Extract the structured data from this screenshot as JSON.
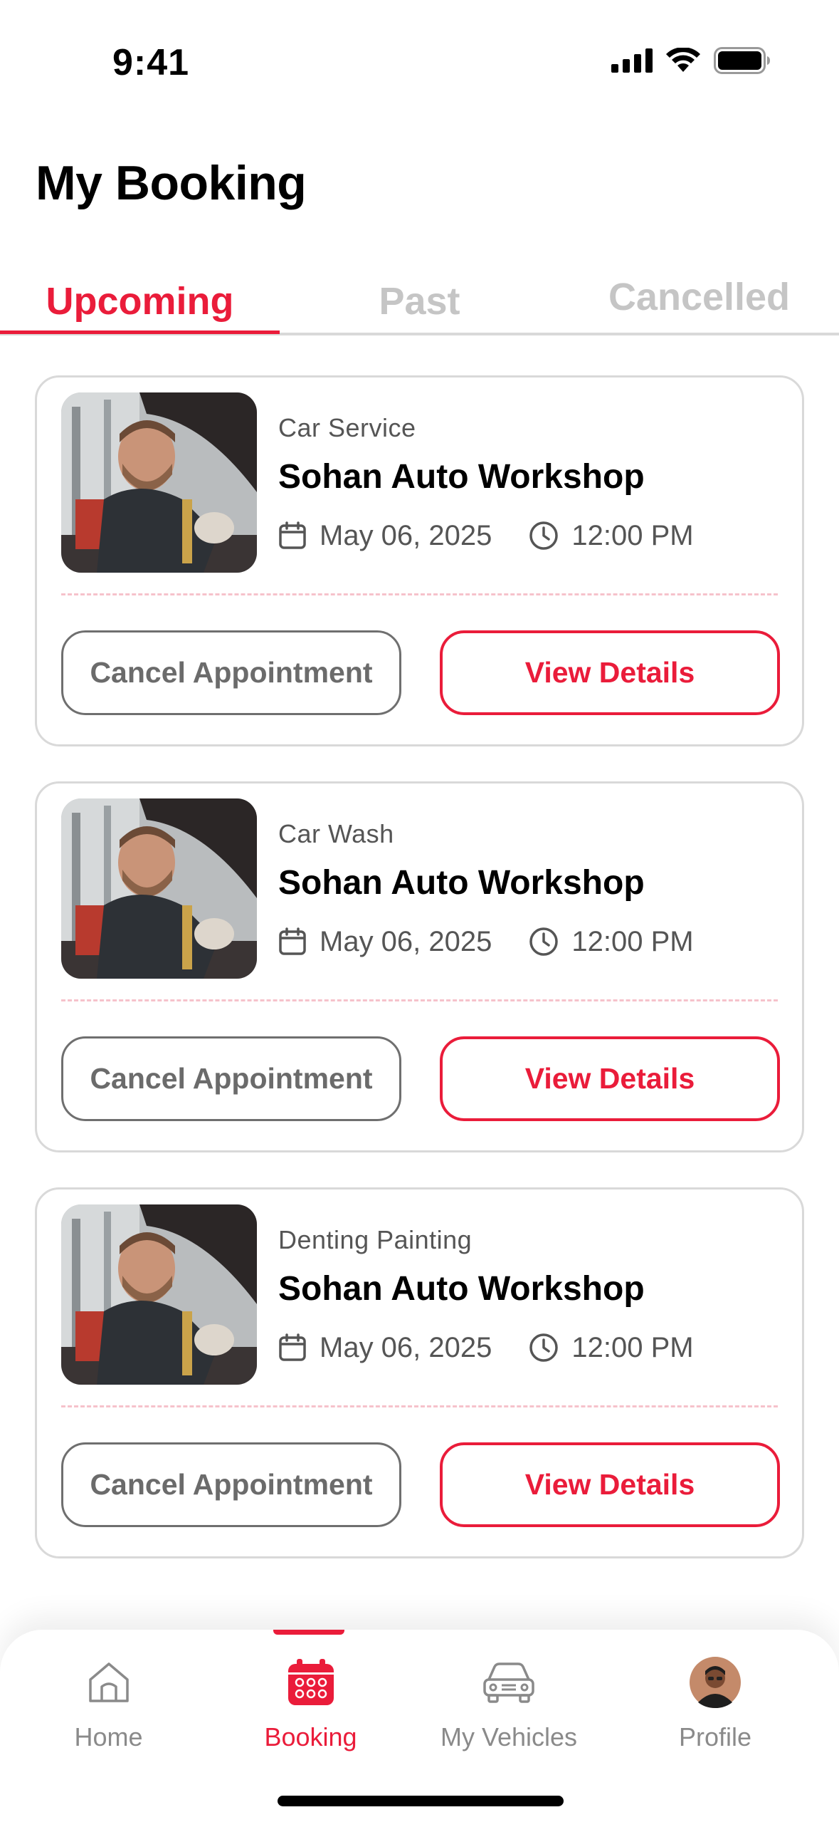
{
  "status_bar": {
    "time": "9:41"
  },
  "page_title": "My Booking",
  "tabs": [
    {
      "label": "Upcoming",
      "active": true
    },
    {
      "label": "Past",
      "active": false
    },
    {
      "label": "Cancelled",
      "active": false
    }
  ],
  "bookings": [
    {
      "category": "Car Service",
      "shop": "Sohan Auto Workshop",
      "date": "May 06, 2025",
      "time": "12:00 PM",
      "cancel_label": "Cancel Appointment",
      "view_label": "View Details"
    },
    {
      "category": "Car Wash",
      "shop": "Sohan Auto Workshop",
      "date": "May 06, 2025",
      "time": "12:00 PM",
      "cancel_label": "Cancel Appointment",
      "view_label": "View Details"
    },
    {
      "category": "Denting Painting",
      "shop": "Sohan Auto Workshop",
      "date": "May 06, 2025",
      "time": "12:00 PM",
      "cancel_label": "Cancel Appointment",
      "view_label": "View Details"
    }
  ],
  "bottom_nav": {
    "items": [
      {
        "label": "Home",
        "icon": "home-icon"
      },
      {
        "label": "Booking",
        "icon": "calendar-icon",
        "active": true
      },
      {
        "label": "My Vehicles",
        "icon": "car-icon"
      },
      {
        "label": "Profile",
        "icon": "avatar"
      }
    ]
  },
  "colors": {
    "accent": "#ea1c3a",
    "muted_text": "#555555",
    "inactive_tab": "#c5c5c5"
  }
}
